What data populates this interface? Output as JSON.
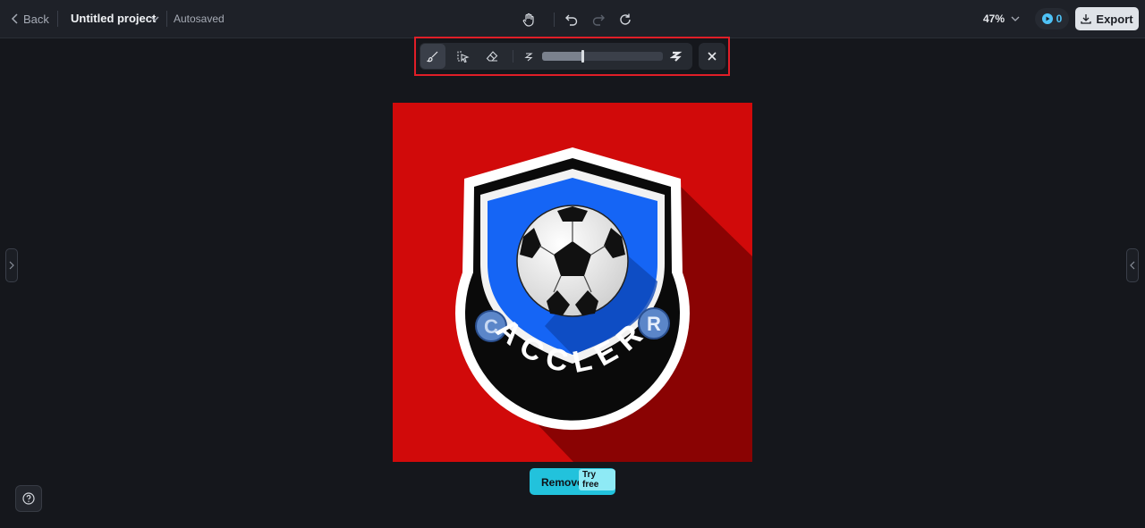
{
  "header": {
    "back_label": "Back",
    "project_title": "Untitled project",
    "save_status": "Autosaved",
    "zoom": "47%",
    "credits": "0",
    "export_label": "Export"
  },
  "canvas": {
    "logo_text": "ACCLER",
    "badge_letters": [
      "C",
      "R"
    ]
  },
  "actions": {
    "remove_label": "Remove",
    "try_free_label": "Try free"
  },
  "brush_size_fraction": 0.33,
  "colors": {
    "accent": "#22c2dc",
    "highlight": "#e01e27",
    "canvas_bg": "#d10a0a",
    "shield_blue": "#1565f5"
  }
}
